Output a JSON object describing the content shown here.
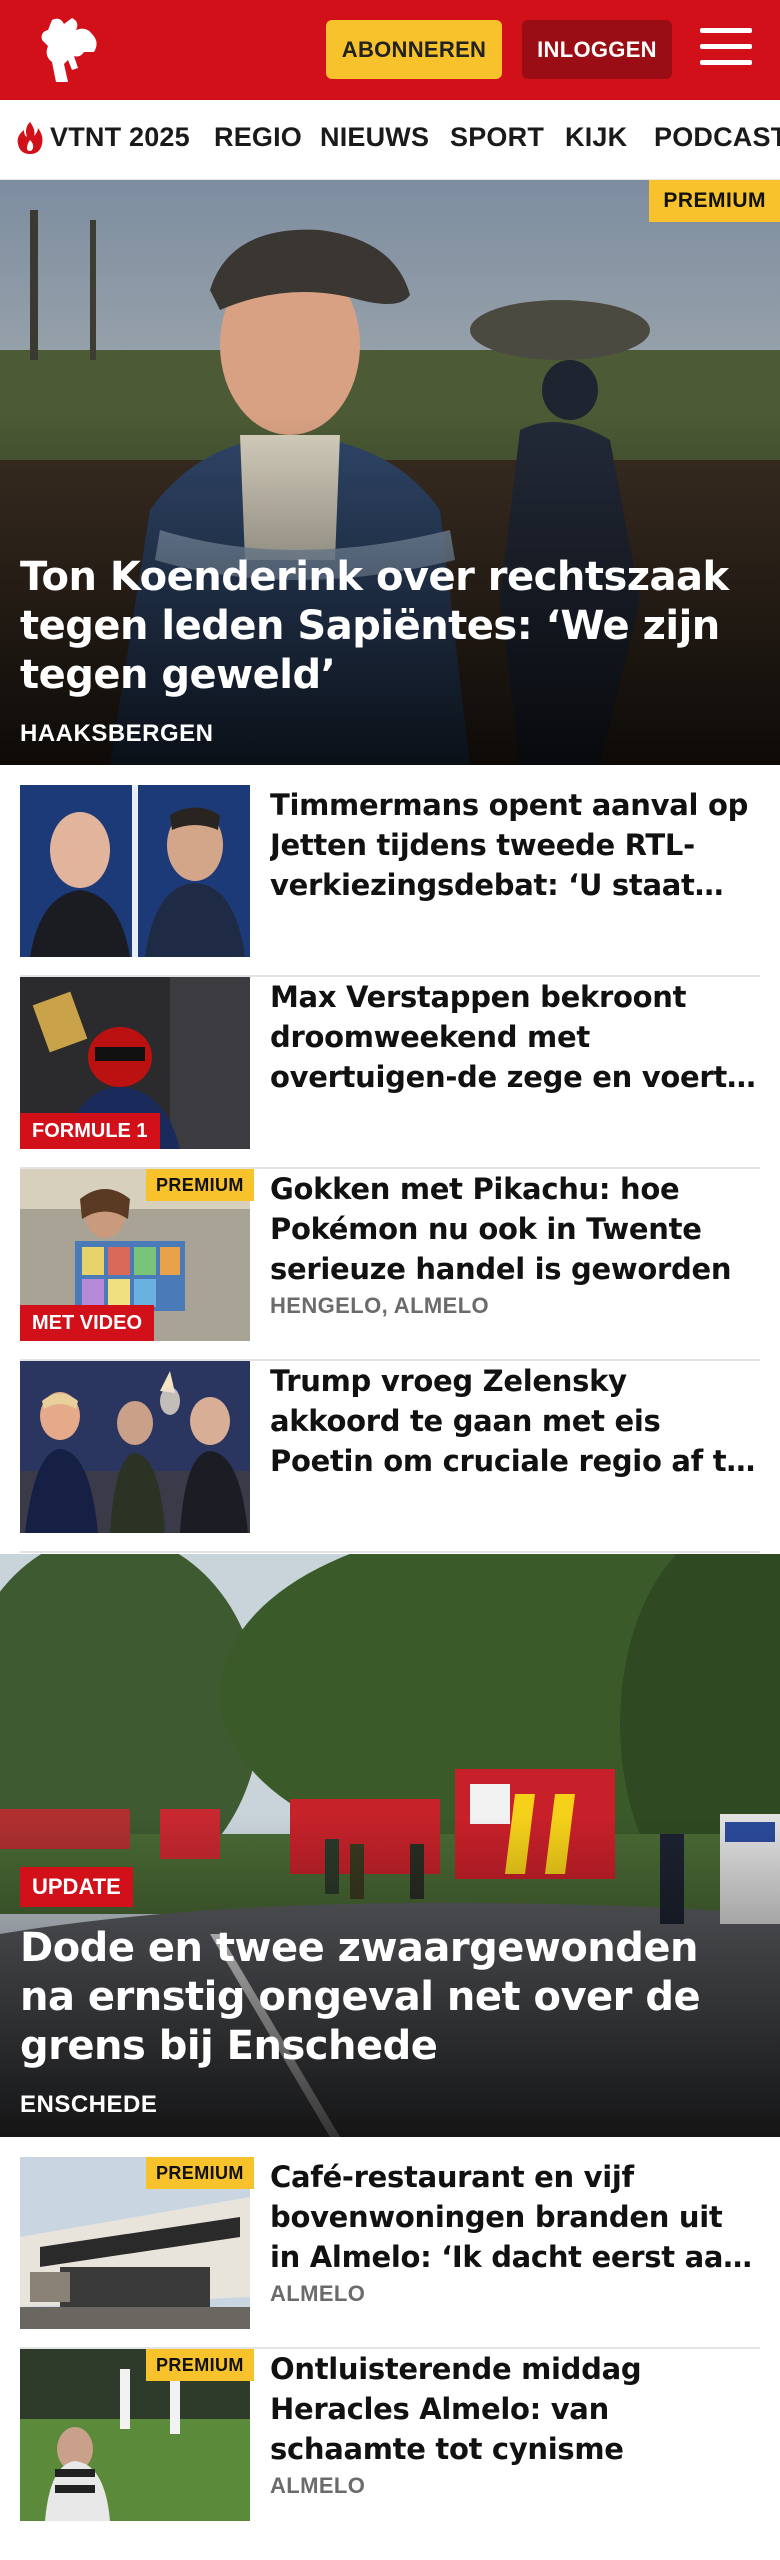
{
  "header": {
    "subscribe_label": "ABONNEREN",
    "login_label": "INLOGGEN",
    "logo_icon": "horse-logo-icon",
    "menu_icon": "hamburger-menu-icon",
    "brand_color": "#d1101a",
    "accent_color": "#f7c22b"
  },
  "nav": {
    "items": [
      {
        "label": "VTNT 2025",
        "icon": "flame-icon"
      },
      {
        "label": "REGIO"
      },
      {
        "label": "NIEUWS"
      },
      {
        "label": "SPORT"
      },
      {
        "label": "KIJK"
      },
      {
        "label": "PODCAST"
      }
    ]
  },
  "hero1": {
    "badge": "PREMIUM",
    "title": "Ton Koenderink over rechtszaak tegen leden Sapiëntes: ‘We zijn tegen geweld’",
    "location": "HAAKSBERGEN"
  },
  "articles": [
    {
      "title": "Timmermans opent aanval op Jetten tijdens tweede RTL-verkiezingsdebat: ‘U staat hier…"
    },
    {
      "title": "Max Verstappen bekroont droomweekend met overtuigen-de zege en voert druk verder op…",
      "tag": "FORMULE 1"
    },
    {
      "title": "Gokken met Pikachu: hoe Pokémon nu ook in Twente serieuze handel is geworden",
      "location": "HENGELO, ALMELO",
      "tag": "MET VIDEO",
      "badge": "PREMIUM"
    },
    {
      "title": "Trump vroeg Zelensky akkoord te gaan met eis Poetin om cruciale regio af te staan: ‘Alsof je een…"
    }
  ],
  "hero2": {
    "badge": "UPDATE",
    "title": "Dode en twee zwaargewonden na ernstig ongeval net over de grens bij Enschede",
    "location": "ENSCHEDE"
  },
  "articles2": [
    {
      "title": "Café-restaurant en vijf bovenwoningen branden uit in Almelo: ‘Ik dacht eerst aan een…",
      "location": "ALMELO",
      "badge": "PREMIUM"
    },
    {
      "title": "Ontluisterende middag Heracles Almelo: van schaamte tot cynisme",
      "location": "ALMELO",
      "badge": "PREMIUM"
    }
  ]
}
